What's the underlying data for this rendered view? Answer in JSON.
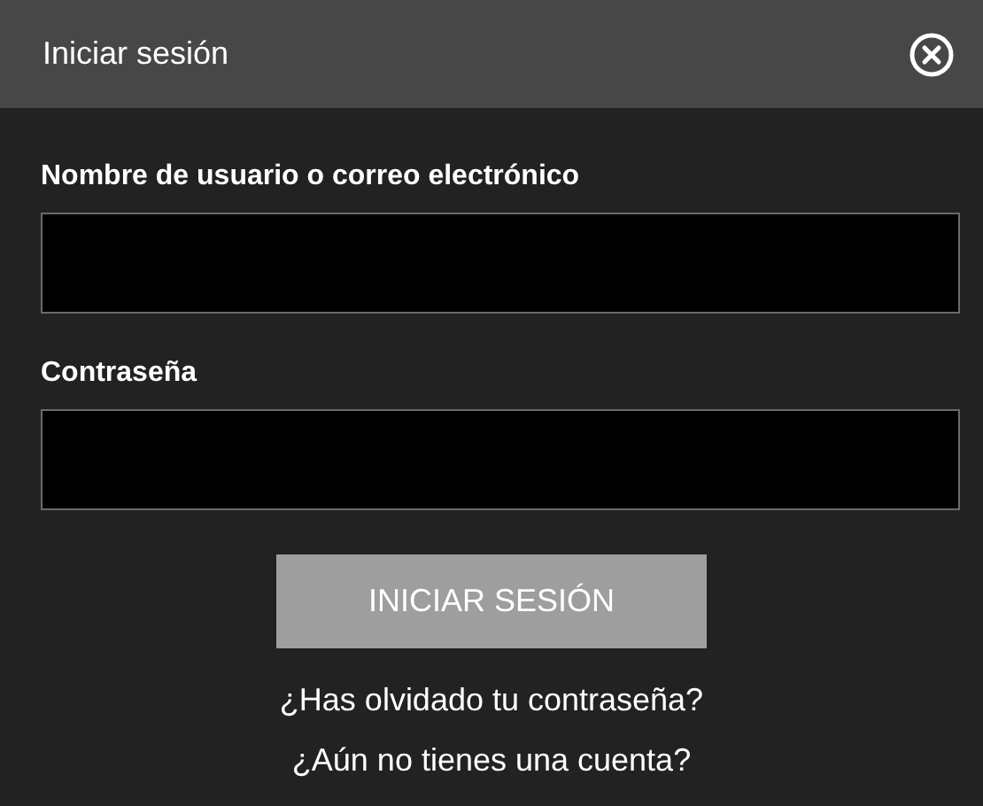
{
  "dialog": {
    "title": "Iniciar sesión"
  },
  "fields": [
    {
      "label": "Nombre de usuario o correo electrónico"
    },
    {
      "label": "Contraseña"
    }
  ],
  "submit_button": "INICIAR SESIÓN",
  "links": [
    "¿Has olvidado tu contraseña?",
    "¿Aún no tienes una cuenta?"
  ]
}
